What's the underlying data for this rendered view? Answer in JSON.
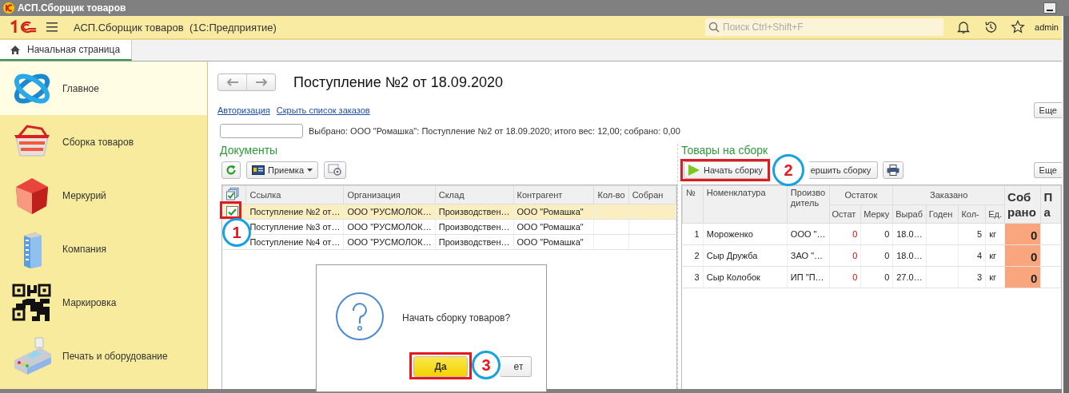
{
  "window": {
    "title": "АСП.Сборщик товаров"
  },
  "app_header": {
    "title": "АСП.Сборщик товаров  (1С:Предприятие)",
    "search": {
      "placeholder": "Поиск Ctrl+Shift+F"
    },
    "user": "admin"
  },
  "tabs": [
    {
      "label": "Начальная страница",
      "selected": true
    }
  ],
  "sidebar": {
    "items": [
      {
        "label": "Главное",
        "kind": "main",
        "selected": true
      },
      {
        "label": "Сборка товаров",
        "kind": "basket",
        "selected": false
      },
      {
        "label": "Меркурий",
        "kind": "cube",
        "selected": false
      },
      {
        "label": "Компания",
        "kind": "building",
        "selected": false
      },
      {
        "label": "Маркировка",
        "kind": "qr",
        "selected": false
      },
      {
        "label": "Печать и оборудование",
        "kind": "terminal",
        "selected": false
      }
    ]
  },
  "document": {
    "title": "Поступление №2 от 18.09.2020",
    "links": [
      "Авторизация",
      "Скрыть список заказов"
    ],
    "more_button": "Еще",
    "selection_info": "Выбрано: ООО \"Ромашка\": Поступление №2 от 18.09.2020; итого вес: 12,00; собрано: 0,00"
  },
  "documents": {
    "title": "Документы",
    "type_menu": "Приемка",
    "columns": [
      "Ссылка",
      "Организация",
      "Склад",
      "Контрагент",
      "Кол-во",
      "Собран"
    ],
    "rows": [
      {
        "checked": true,
        "selected": true,
        "cells": [
          "Поступление №2 от…",
          "ООО \"РУСМОЛОК…",
          "Производствен…",
          "ООО \"Ромашка\""
        ]
      },
      {
        "selected": false,
        "cells": [
          "Поступление №3 от…",
          "ООО \"РУСМОЛОК…",
          "Производствен…",
          "ООО \"Ромашка\""
        ]
      },
      {
        "selected": false,
        "cells": [
          "Поступление №4 от…",
          "ООО \"РУСМОЛОК…",
          "Производствен…",
          "ООО \"Ромашка\""
        ]
      }
    ]
  },
  "goods": {
    "title": "Товары на сборк",
    "buttons": [
      {
        "label": "Начать сборку",
        "kind": "start"
      },
      {
        "label": "ершить сборку",
        "kind": "finish"
      },
      {
        "kind": "print"
      }
    ],
    "more_button": "Еще",
    "columns": [
      {
        "label": "№",
        "kind": "plain"
      },
      {
        "label": "Номенклатура",
        "kind": "plain"
      },
      {
        "label": "Производитель",
        "kind": "plain"
      },
      {
        "label": "Остаток",
        "kind": "group",
        "children": [
          "Остат",
          "Мерку"
        ]
      },
      {
        "label": "Заказано",
        "kind": "group",
        "children": [
          "Выраб",
          "Годен",
          "Кол-",
          "Ед."
        ]
      },
      {
        "label": "Собрано",
        "kind": "big"
      },
      {
        "label": "Па",
        "kind": "big"
      }
    ],
    "rows": [
      {
        "num": "1",
        "name": "Мороженко",
        "producer": "ООО \"…",
        "stock": "0",
        "mercury": "0",
        "produced": "18.0…",
        "qty": "5",
        "unit": "кг",
        "collected": "0"
      },
      {
        "num": "2",
        "name": "Сыр Дружба",
        "producer": "ЗАО \"…",
        "stock": "0",
        "mercury": "0",
        "produced": "18.0…",
        "qty": "4",
        "unit": "кг",
        "collected": "0"
      },
      {
        "num": "3",
        "name": "Сыр Колобок",
        "producer": "ИП \"П…",
        "stock": "0",
        "mercury": "0",
        "produced": "27.0…",
        "qty": "3",
        "unit": "кг",
        "collected": "0"
      }
    ]
  },
  "dialog": {
    "message": "Начать сборку товаров?",
    "buttons": [
      {
        "label": "Да",
        "default": true
      },
      {
        "label": "ет",
        "default": false
      }
    ]
  },
  "annotations": [
    "1",
    "2",
    "3"
  ]
}
